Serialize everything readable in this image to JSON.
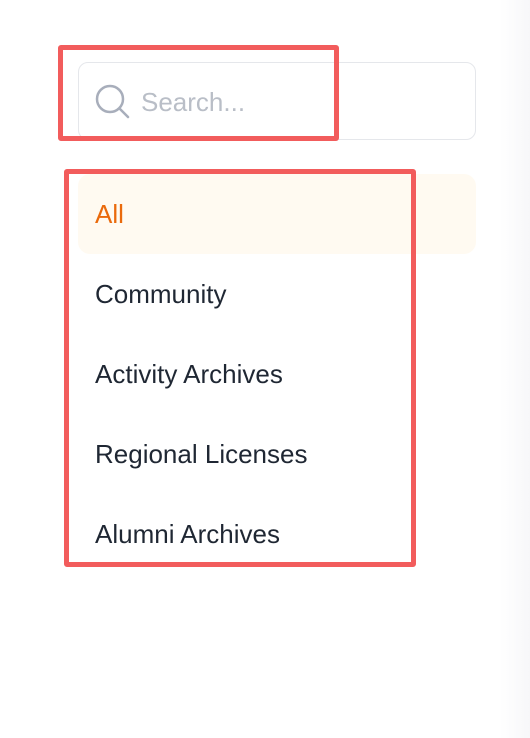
{
  "search": {
    "placeholder": "Search...",
    "value": "",
    "icon": "search-icon"
  },
  "categories": {
    "active_index": 0,
    "items": [
      {
        "label": "All",
        "active": true
      },
      {
        "label": "Community",
        "active": false
      },
      {
        "label": "Activity Archives",
        "active": false
      },
      {
        "label": "Regional Licenses",
        "active": false
      },
      {
        "label": "Alumni Archives",
        "active": false
      }
    ]
  },
  "colors": {
    "active_text": "#ea6a0c",
    "active_background": "#fffaf1",
    "text": "#1f2733",
    "placeholder": "#b9bec7",
    "border": "#e5e7eb",
    "highlight_outline": "#f25c5c"
  }
}
